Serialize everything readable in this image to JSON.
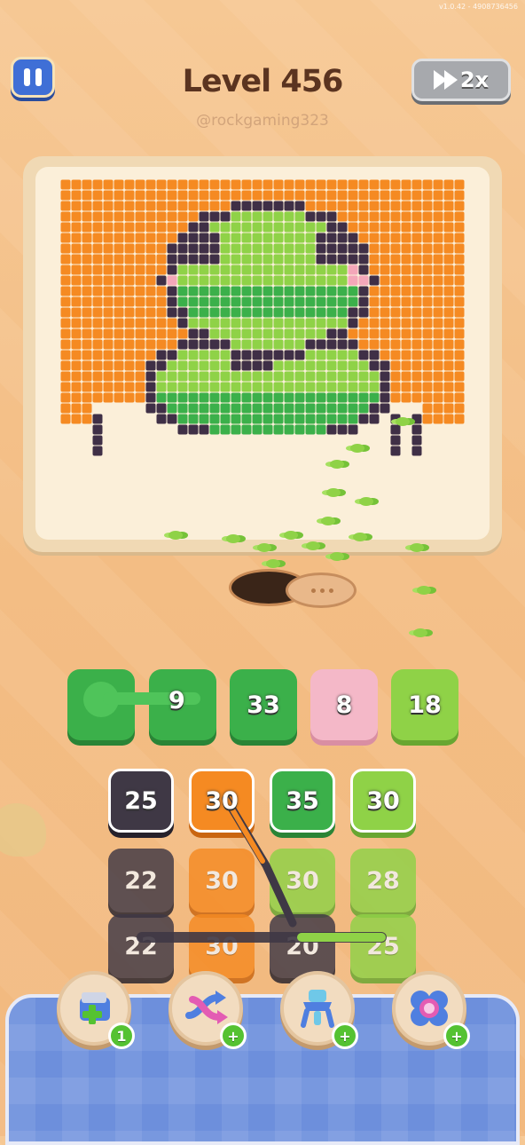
{
  "version_text": "v1.0.42 - 4908736456",
  "header": {
    "title": "Level 456",
    "handle": "@rockgaming323",
    "speed_label": "2x"
  },
  "colors": {
    "orange": "#f58a22",
    "outline": "#3f2f46",
    "green_light": "#8fd247",
    "green_dark": "#3bb04a",
    "blush": "#f4a7b9",
    "board": "#fbefd9"
  },
  "conveyor": [
    {
      "value": "9",
      "color": "#3bb04a"
    },
    {
      "value": "33",
      "color": "#3bb04a"
    },
    {
      "value": "8",
      "color": "#f4b8c8"
    },
    {
      "value": "18",
      "color": "#8fd247"
    }
  ],
  "grid": [
    [
      {
        "value": "25",
        "color": "#3f3845"
      },
      {
        "value": "30",
        "color": "#f58a22"
      },
      {
        "value": "35",
        "color": "#3bb04a"
      },
      {
        "value": "30",
        "color": "#8fd247"
      }
    ],
    [
      {
        "value": "22",
        "color": "#3f3845"
      },
      {
        "value": "30",
        "color": "#f58a22"
      },
      {
        "value": "30",
        "color": "#8fd247"
      },
      {
        "value": "28",
        "color": "#8fd247"
      }
    ],
    [
      {
        "value": "22",
        "color": "#3f3845"
      },
      {
        "value": "30",
        "color": "#f58a22"
      },
      {
        "value": "20",
        "color": "#3f3845"
      },
      {
        "value": "25",
        "color": "#8fd247"
      }
    ]
  ],
  "boosters": [
    {
      "icon": "add-box-icon",
      "badge": "1"
    },
    {
      "icon": "shuffle-arrows-icon",
      "badge": "+"
    },
    {
      "icon": "magnet-claw-icon",
      "badge": "+"
    },
    {
      "icon": "color-swap-icon",
      "badge": "+"
    }
  ]
}
